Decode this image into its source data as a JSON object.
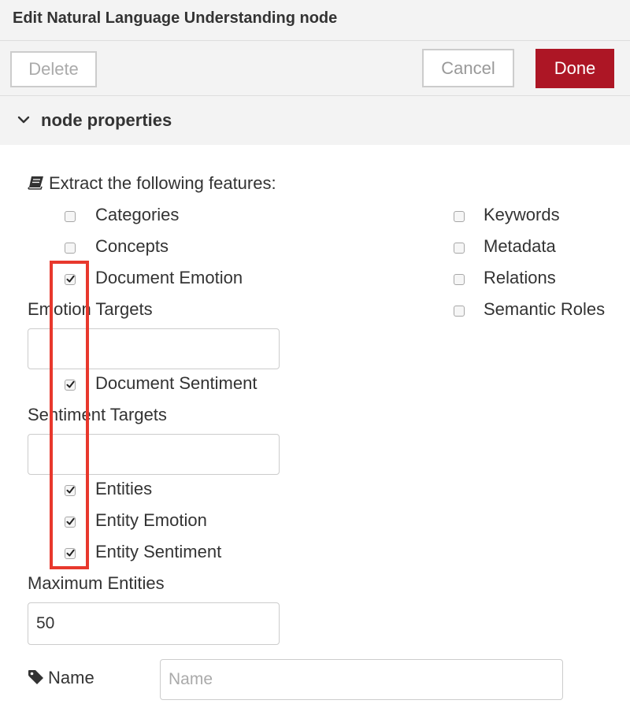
{
  "dialog": {
    "title": "Edit Natural Language Understanding node",
    "delete_label": "Delete",
    "cancel_label": "Cancel",
    "done_label": "Done",
    "section_title": "node properties"
  },
  "features": {
    "heading": "Extract the following features:",
    "left": [
      {
        "label": "Categories",
        "checked": false
      },
      {
        "label": "Concepts",
        "checked": false
      },
      {
        "label": "Document Emotion",
        "checked": true
      },
      {
        "label": "Document Sentiment",
        "checked": true
      },
      {
        "label": "Entities",
        "checked": true
      },
      {
        "label": "Entity Emotion",
        "checked": true
      },
      {
        "label": "Entity Sentiment",
        "checked": true
      }
    ],
    "right": [
      {
        "label": "Keywords",
        "checked": false
      },
      {
        "label": "Metadata",
        "checked": false
      },
      {
        "label": "Relations",
        "checked": false
      },
      {
        "label": "Semantic Roles",
        "checked": false
      }
    ]
  },
  "emotion_targets": {
    "label": "Emotion Targets",
    "value": ""
  },
  "sentiment_targets": {
    "label": "Sentiment Targets",
    "value": ""
  },
  "max_entities": {
    "label": "Maximum Entities",
    "value": "50"
  },
  "name_field": {
    "label": "Name",
    "placeholder": "Name",
    "value": ""
  },
  "colors": {
    "done_button": "#ad1625",
    "highlight": "#e8382d"
  }
}
